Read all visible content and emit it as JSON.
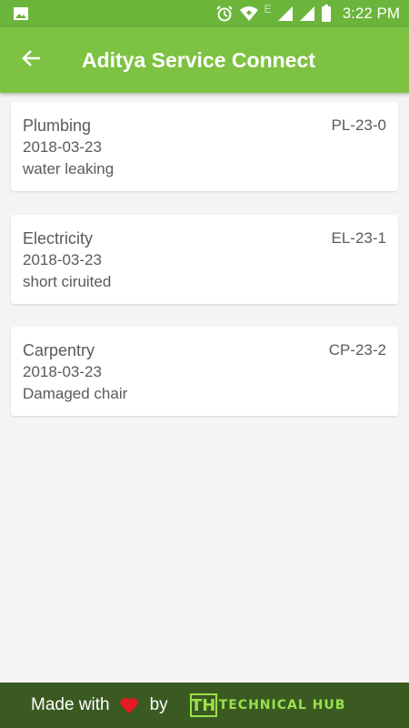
{
  "status_bar": {
    "time": "3:22 PM",
    "network_type": "E",
    "icons": [
      "image-icon",
      "alarm-icon",
      "wifi-icon",
      "signal-icon",
      "signal-icon",
      "battery-icon"
    ]
  },
  "app_bar": {
    "title": "Aditya Service Connect",
    "back_icon": "arrow-back-icon"
  },
  "complaints": [
    {
      "category": "Plumbing",
      "date": "2018-03-23",
      "description": "water leaking",
      "code": "PL-23-0"
    },
    {
      "category": "Electricity",
      "date": "2018-03-23",
      "description": "short ciruited",
      "code": "EL-23-1"
    },
    {
      "category": "Carpentry",
      "date": "2018-03-23",
      "description": "Damaged chair",
      "code": "CP-23-2"
    }
  ],
  "footer": {
    "made_with": "Made with",
    "by": "by",
    "logo_mark": "TH",
    "logo_text": "TECHNICAL HUB",
    "heart_color": "#e31b23"
  },
  "colors": {
    "status_bar": "#6bb53b",
    "app_bar": "#7dc242",
    "footer": "#3a5a22",
    "logo": "#9be04a"
  }
}
